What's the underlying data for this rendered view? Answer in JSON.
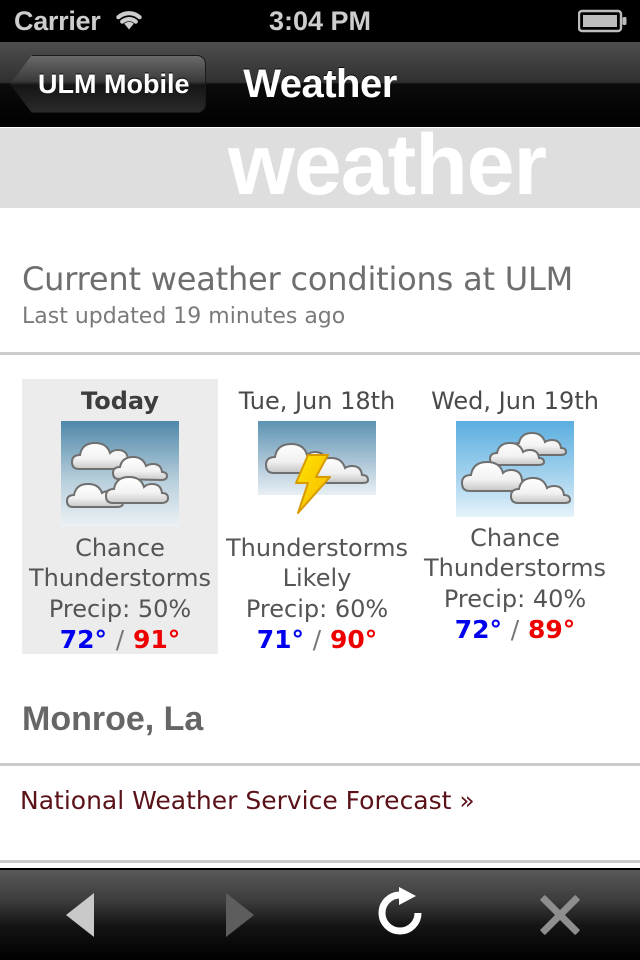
{
  "status_bar": {
    "carrier": "Carrier",
    "wifi_icon": "wifi-icon",
    "time": "3:04 PM",
    "battery_icon": "battery-full-icon"
  },
  "nav_bar": {
    "back_label": "ULM Mobile",
    "title": "Weather"
  },
  "banner": {
    "word": "weather"
  },
  "page": {
    "heading": "Current weather conditions at ULM",
    "subheading": "Last updated 19 minutes ago",
    "location": "Monroe, La",
    "link_label": "National Weather Service Forecast »"
  },
  "forecast": [
    {
      "day": "Today",
      "icon": "overcast-clouds-icon",
      "condition": "Chance\nThunderstorms",
      "condition_line1": "Chance",
      "condition_line2": "Thunderstorms",
      "precip": "Precip: 50%",
      "low": "72°",
      "separator": "/",
      "high": "91°",
      "highlighted": true
    },
    {
      "day": "Tue, Jun 18th",
      "icon": "thunderstorm-icon",
      "condition": "Thunderstorms\nLikely",
      "condition_line1": "Thunderstorms",
      "condition_line2": "Likely",
      "precip": "Precip: 60%",
      "low": "71°",
      "separator": "/",
      "high": "90°",
      "highlighted": false
    },
    {
      "day": "Wed, Jun 19th",
      "icon": "partly-cloudy-clouds-icon",
      "condition": "Chance\nThunderstorms",
      "condition_line1": "Chance",
      "condition_line2": "Thunderstorms",
      "precip": "Precip: 40%",
      "low": "72°",
      "separator": "/",
      "high": "89°",
      "highlighted": false
    }
  ],
  "toolbar": {
    "back_icon": "back-arrow-icon",
    "forward_icon": "forward-arrow-icon",
    "reload_icon": "reload-icon",
    "close_icon": "close-x-icon"
  },
  "colors": {
    "low_temp": "#0000ee",
    "high_temp": "#ee0000",
    "link": "#5a1118",
    "banner_bg": "#dedede",
    "card_highlight_bg": "#ececec",
    "rule": "#cccccc"
  }
}
